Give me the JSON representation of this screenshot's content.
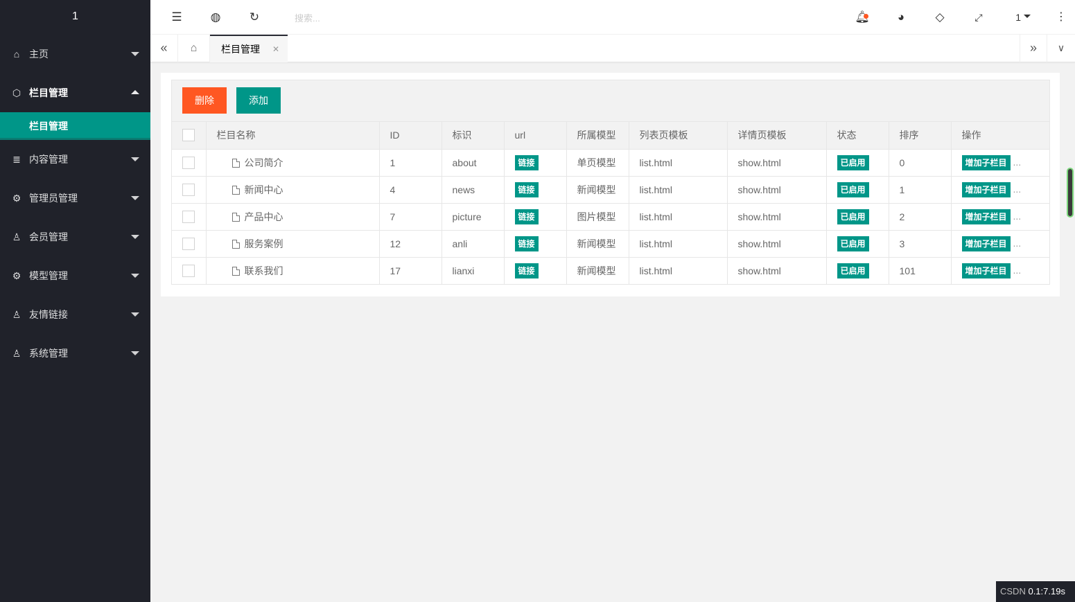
{
  "logo": "1",
  "sidebar": {
    "items": [
      {
        "label": "主页",
        "icon": "home-icon"
      },
      {
        "label": "栏目管理",
        "icon": "cube-icon",
        "open": true,
        "child": "栏目管理"
      },
      {
        "label": "内容管理",
        "icon": "list-icon"
      },
      {
        "label": "管理员管理",
        "icon": "gear-icon"
      },
      {
        "label": "会员管理",
        "icon": "user-icon"
      },
      {
        "label": "模型管理",
        "icon": "gear-icon"
      },
      {
        "label": "友情链接",
        "icon": "user-icon"
      },
      {
        "label": "系统管理",
        "icon": "user-icon"
      }
    ]
  },
  "header": {
    "search_placeholder": "搜索...",
    "user": "1"
  },
  "tabs": {
    "active": "栏目管理"
  },
  "toolbar": {
    "delete_label": "删除",
    "add_label": "添加"
  },
  "table": {
    "columns": [
      "栏目名称",
      "ID",
      "标识",
      "url",
      "所属模型",
      "列表页模板",
      "详情页模板",
      "状态",
      "排序",
      "操作"
    ],
    "rows": [
      {
        "name": "公司简介",
        "id": "1",
        "ident": "about",
        "url": "链接",
        "model": "单页模型",
        "list_tpl": "list.html",
        "detail_tpl": "show.html",
        "status": "已启用",
        "sort": "0",
        "action": "增加子栏目"
      },
      {
        "name": "新闻中心",
        "id": "4",
        "ident": "news",
        "url": "链接",
        "model": "新闻模型",
        "list_tpl": "list.html",
        "detail_tpl": "show.html",
        "status": "已启用",
        "sort": "1",
        "action": "增加子栏目"
      },
      {
        "name": "产品中心",
        "id": "7",
        "ident": "picture",
        "url": "链接",
        "model": "图片模型",
        "list_tpl": "list.html",
        "detail_tpl": "show.html",
        "status": "已启用",
        "sort": "2",
        "action": "增加子栏目"
      },
      {
        "name": "服务案例",
        "id": "12",
        "ident": "anli",
        "url": "链接",
        "model": "新闻模型",
        "list_tpl": "list.html",
        "detail_tpl": "show.html",
        "status": "已启用",
        "sort": "3",
        "action": "增加子栏目"
      },
      {
        "name": "联系我们",
        "id": "17",
        "ident": "lianxi",
        "url": "链接",
        "model": "新闻模型",
        "list_tpl": "list.html",
        "detail_tpl": "show.html",
        "status": "已启用",
        "sort": "101",
        "action": "增加子栏目"
      }
    ],
    "more": "..."
  },
  "watermark": {
    "prefix": "CSDN",
    "text": "0.1:7.19s"
  },
  "colors": {
    "sidebar": "#20222a",
    "accent": "#009688",
    "danger": "#ff5722"
  }
}
